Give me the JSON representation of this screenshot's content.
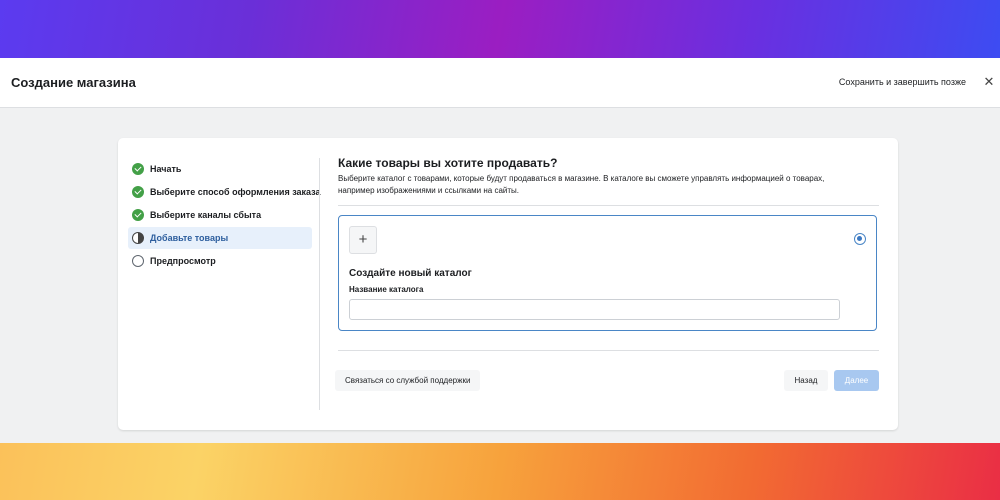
{
  "header": {
    "title": "Создание магазина",
    "save_later": "Сохранить и завершить позже",
    "close_symbol": "✕"
  },
  "steps": [
    {
      "label": "Начать",
      "status": "done"
    },
    {
      "label": "Выберите способ оформления заказа",
      "status": "done"
    },
    {
      "label": "Выберите каналы сбыта",
      "status": "done"
    },
    {
      "label": "Добавьте товары",
      "status": "current"
    },
    {
      "label": "Предпросмотр",
      "status": "pending"
    }
  ],
  "main": {
    "title": "Какие товары вы хотите продавать?",
    "description": "Выберите каталог с товарами, которые будут продаваться в магазине. В каталоге вы сможете управлять информацией о товарах, например изображениями и ссылками на сайты."
  },
  "catalog_option": {
    "add_symbol": "+",
    "title": "Создайте новый каталог",
    "field_label": "Название каталога",
    "field_value": "",
    "selected": true
  },
  "footer": {
    "support_label": "Связаться со службой поддержки",
    "back_label": "Назад",
    "next_label": "Далее"
  },
  "colors": {
    "accent": "#4a86c6",
    "done": "#43a047",
    "next_disabled": "#a8c8f0"
  }
}
